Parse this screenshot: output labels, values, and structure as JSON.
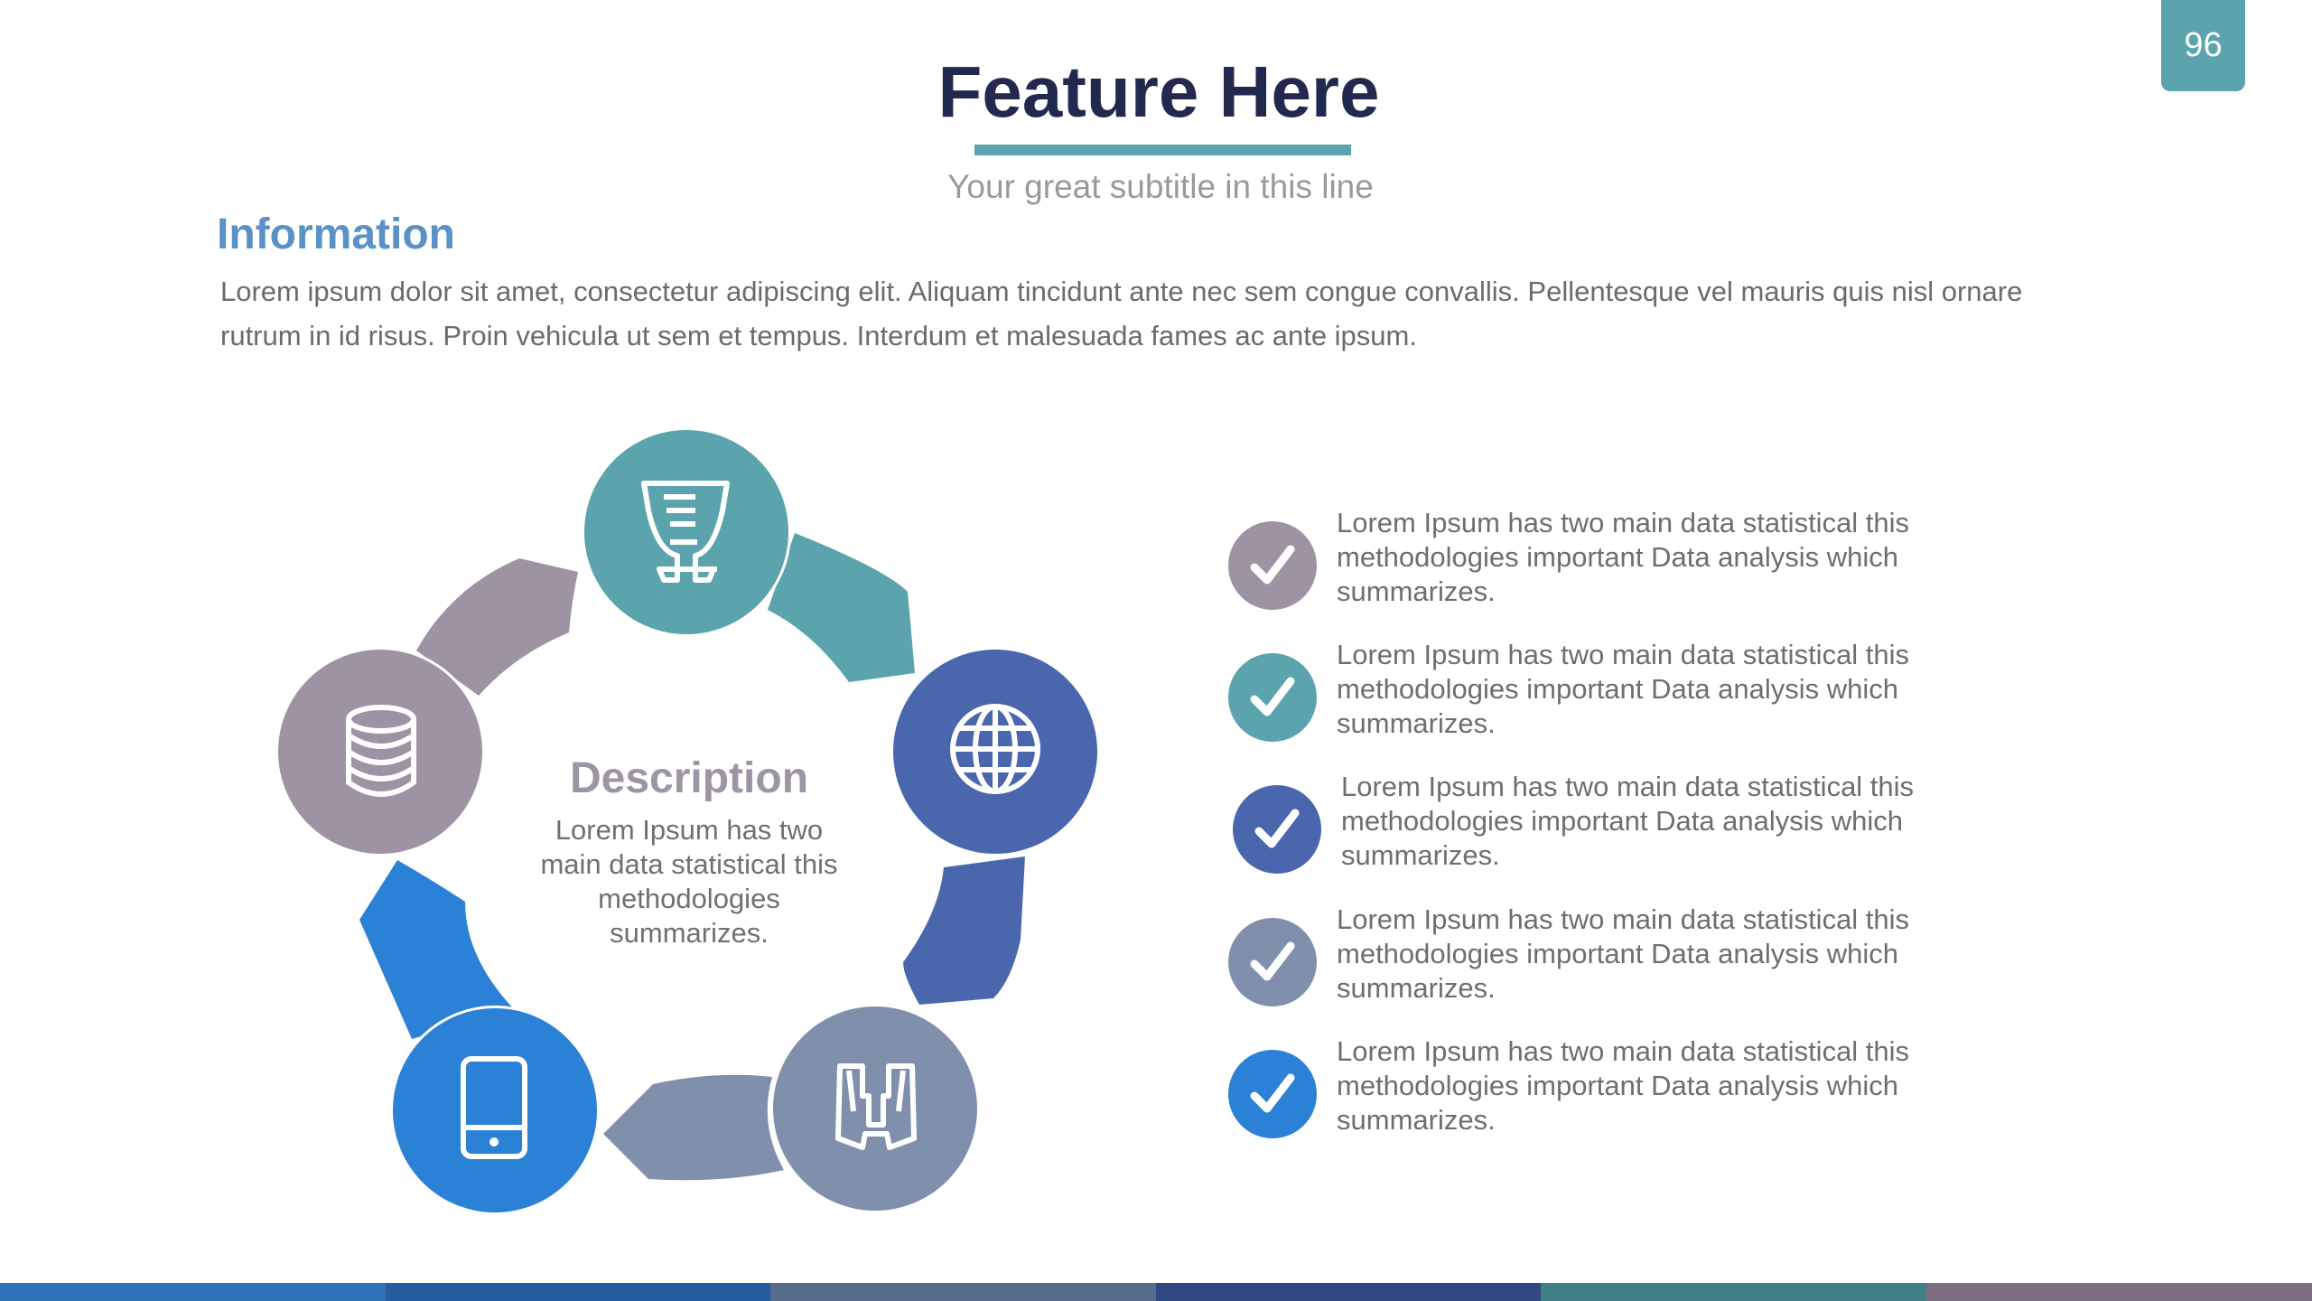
{
  "page_number": "96",
  "title": "Feature Here",
  "subtitle": "Your great subtitle in this line",
  "info": {
    "heading": "Information",
    "body": "Lorem ipsum dolor sit amet, consectetur adipiscing elit. Aliquam tincidunt ante nec sem congue convallis. Pellentesque vel mauris quis nisl ornare rutrum in id risus. Proin vehicula ut sem et tempus. Interdum et malesuada fames ac ante ipsum."
  },
  "cycle": {
    "center_title": "Description",
    "center_body": "Lorem Ipsum has two main data statistical this methodologies summarizes.",
    "nodes": [
      {
        "icon": "trophy-icon",
        "color": "#5ba3ad"
      },
      {
        "icon": "globe-icon",
        "color": "#4a67ae"
      },
      {
        "icon": "binoculars-icon",
        "color": "#8090ac"
      },
      {
        "icon": "tablet-icon",
        "color": "#2b81d6"
      },
      {
        "icon": "database-icon",
        "color": "#9d93a3"
      }
    ]
  },
  "bullets": [
    {
      "text": "Lorem Ipsum has two main data statistical this methodologies important Data analysis which summarizes.",
      "color": "#9d93a3"
    },
    {
      "text": "Lorem Ipsum has two main data statistical this methodologies important Data analysis which summarizes.",
      "color": "#5ba3ad"
    },
    {
      "text": "Lorem Ipsum has two main data statistical this methodologies important Data analysis which summarizes.",
      "color": "#4a67ae"
    },
    {
      "text": "Lorem Ipsum has two main data statistical this methodologies important Data analysis which summarizes.",
      "color": "#8090ac"
    },
    {
      "text": "Lorem Ipsum has two main data statistical this methodologies important Data analysis which summarizes.",
      "color": "#2b81d6"
    }
  ],
  "footer_colors": [
    "#2e72b8",
    "#245da0",
    "#566c8a",
    "#2f4a82",
    "#3f7f86",
    "#7b6e80"
  ]
}
